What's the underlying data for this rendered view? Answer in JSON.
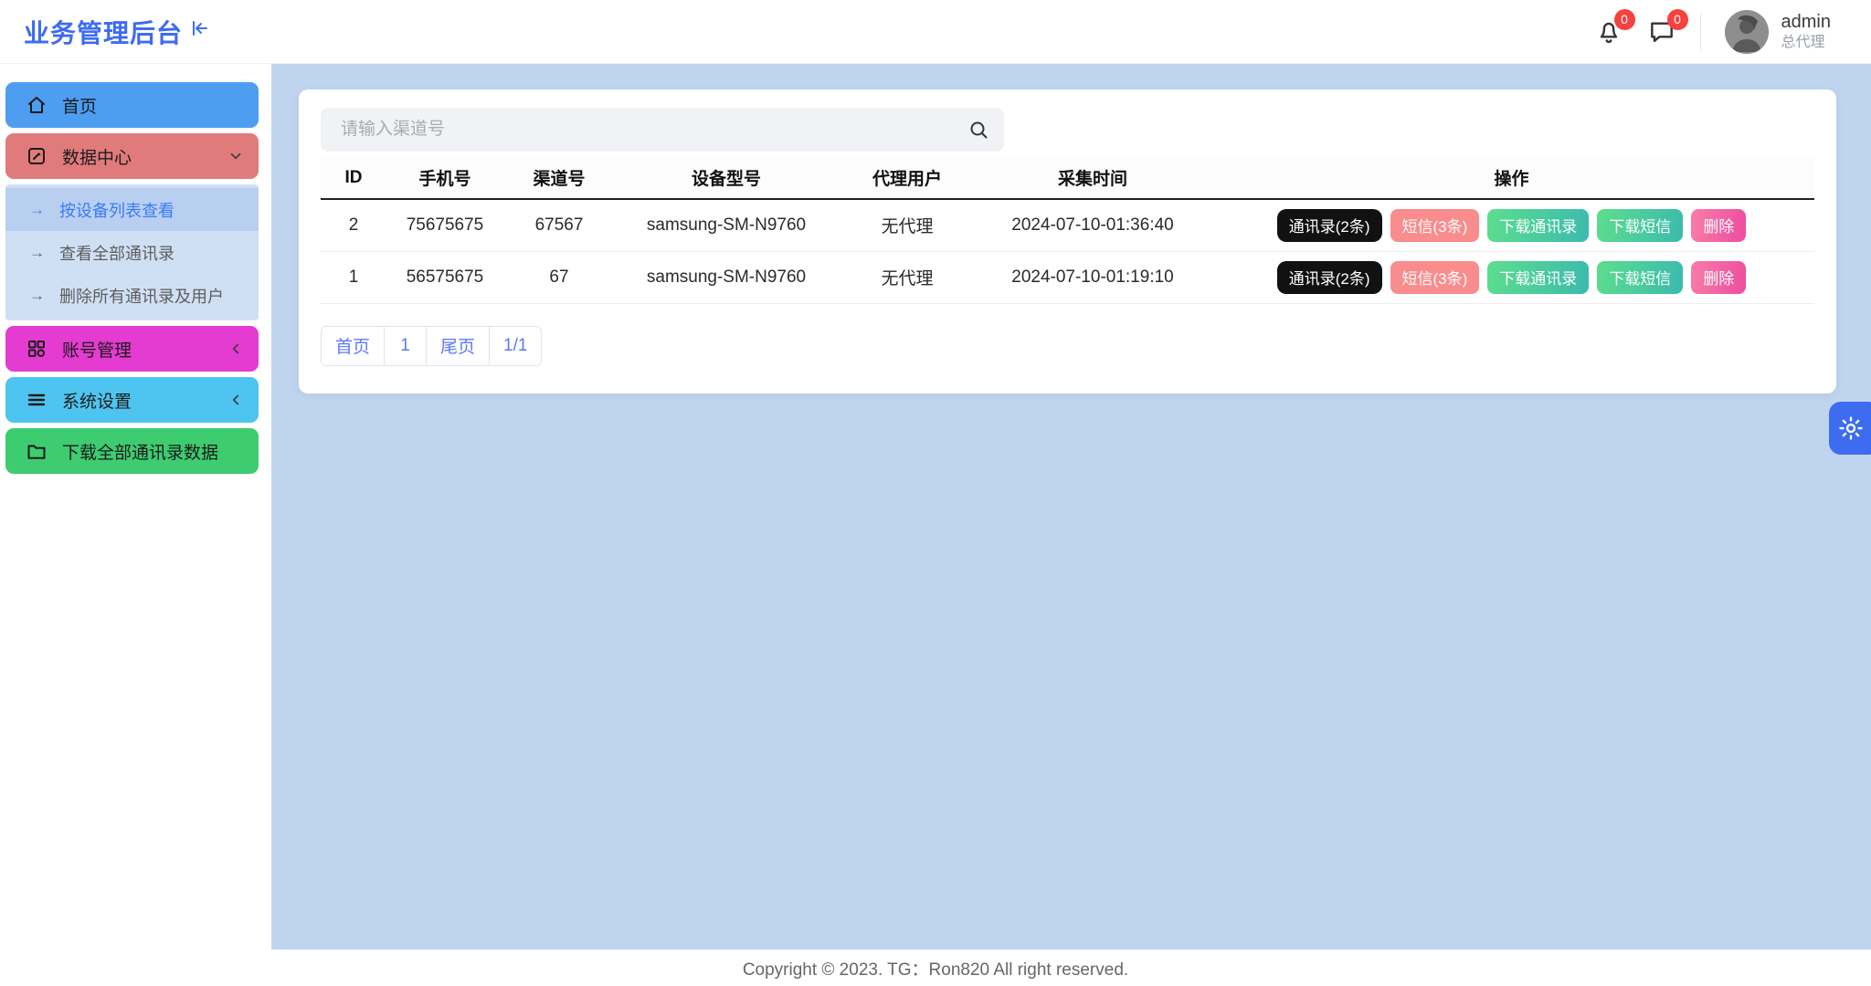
{
  "app": {
    "title": "业务管理后台"
  },
  "topbar": {
    "notification_count": "0",
    "message_count": "0",
    "user": {
      "name": "admin",
      "role": "总代理"
    }
  },
  "sidebar": {
    "items": [
      {
        "label": "首页"
      },
      {
        "label": "数据中心"
      },
      {
        "label": "账号管理"
      },
      {
        "label": "系统设置"
      },
      {
        "label": "下载全部通讯录数据"
      }
    ],
    "submenu": [
      {
        "label": "按设备列表查看",
        "arrow": "→"
      },
      {
        "label": "查看全部通讯录",
        "arrow": "→"
      },
      {
        "label": "删除所有通讯录及用户",
        "arrow": "→"
      }
    ]
  },
  "search": {
    "placeholder": "请输入渠道号"
  },
  "table": {
    "columns": [
      "ID",
      "手机号",
      "渠道号",
      "设备型号",
      "代理用户",
      "采集时间",
      "操作"
    ],
    "rows": [
      {
        "id": "2",
        "phone": "75675675",
        "channel": "67567",
        "device": "samsung-SM-N9760",
        "agent": "无代理",
        "time": "2024-07-10-01:36:40",
        "actions": {
          "contacts": "通讯录(2条)",
          "sms": "短信(3条)",
          "download_contacts": "下载通讯录",
          "download_sms": "下载短信",
          "delete": "删除"
        }
      },
      {
        "id": "1",
        "phone": "56575675",
        "channel": "67",
        "device": "samsung-SM-N9760",
        "agent": "无代理",
        "time": "2024-07-10-01:19:10",
        "actions": {
          "contacts": "通讯录(2条)",
          "sms": "短信(3条)",
          "download_contacts": "下载通讯录",
          "download_sms": "下载短信",
          "delete": "删除"
        }
      }
    ]
  },
  "pagination": {
    "items": [
      "首页",
      "1",
      "尾页",
      "1/1"
    ]
  },
  "footer": {
    "copyright": "Copyright © 2023. TG：Ron820 All right reserved."
  },
  "colors": {
    "title_blue": "#3D6BF2",
    "menu_home_blue": "#4D9DF1",
    "menu_data_red": "#E17B7B",
    "menu_account_magenta": "#E43BD0",
    "menu_system_blue": "#4EC5F0",
    "menu_download_green": "#3ECC70",
    "submenu_bg": "#D0E0F4",
    "submenu_active_bg": "#B9CFF0",
    "submenu_active_text": "#3B7CF6",
    "page_bg": "#BFD5EF",
    "badge_red": "#F5413F",
    "btn_black": "#111111",
    "btn_salmon": "#F98C8C",
    "btn_teal_from": "#5CDE8D",
    "btn_teal_to": "#3BBAAE",
    "btn_pink_from": "#F87DA9",
    "btn_pink_to": "#EE4C9F",
    "pagination_blue": "#5B7AF7",
    "fab_blue": "#3D6CF1"
  }
}
